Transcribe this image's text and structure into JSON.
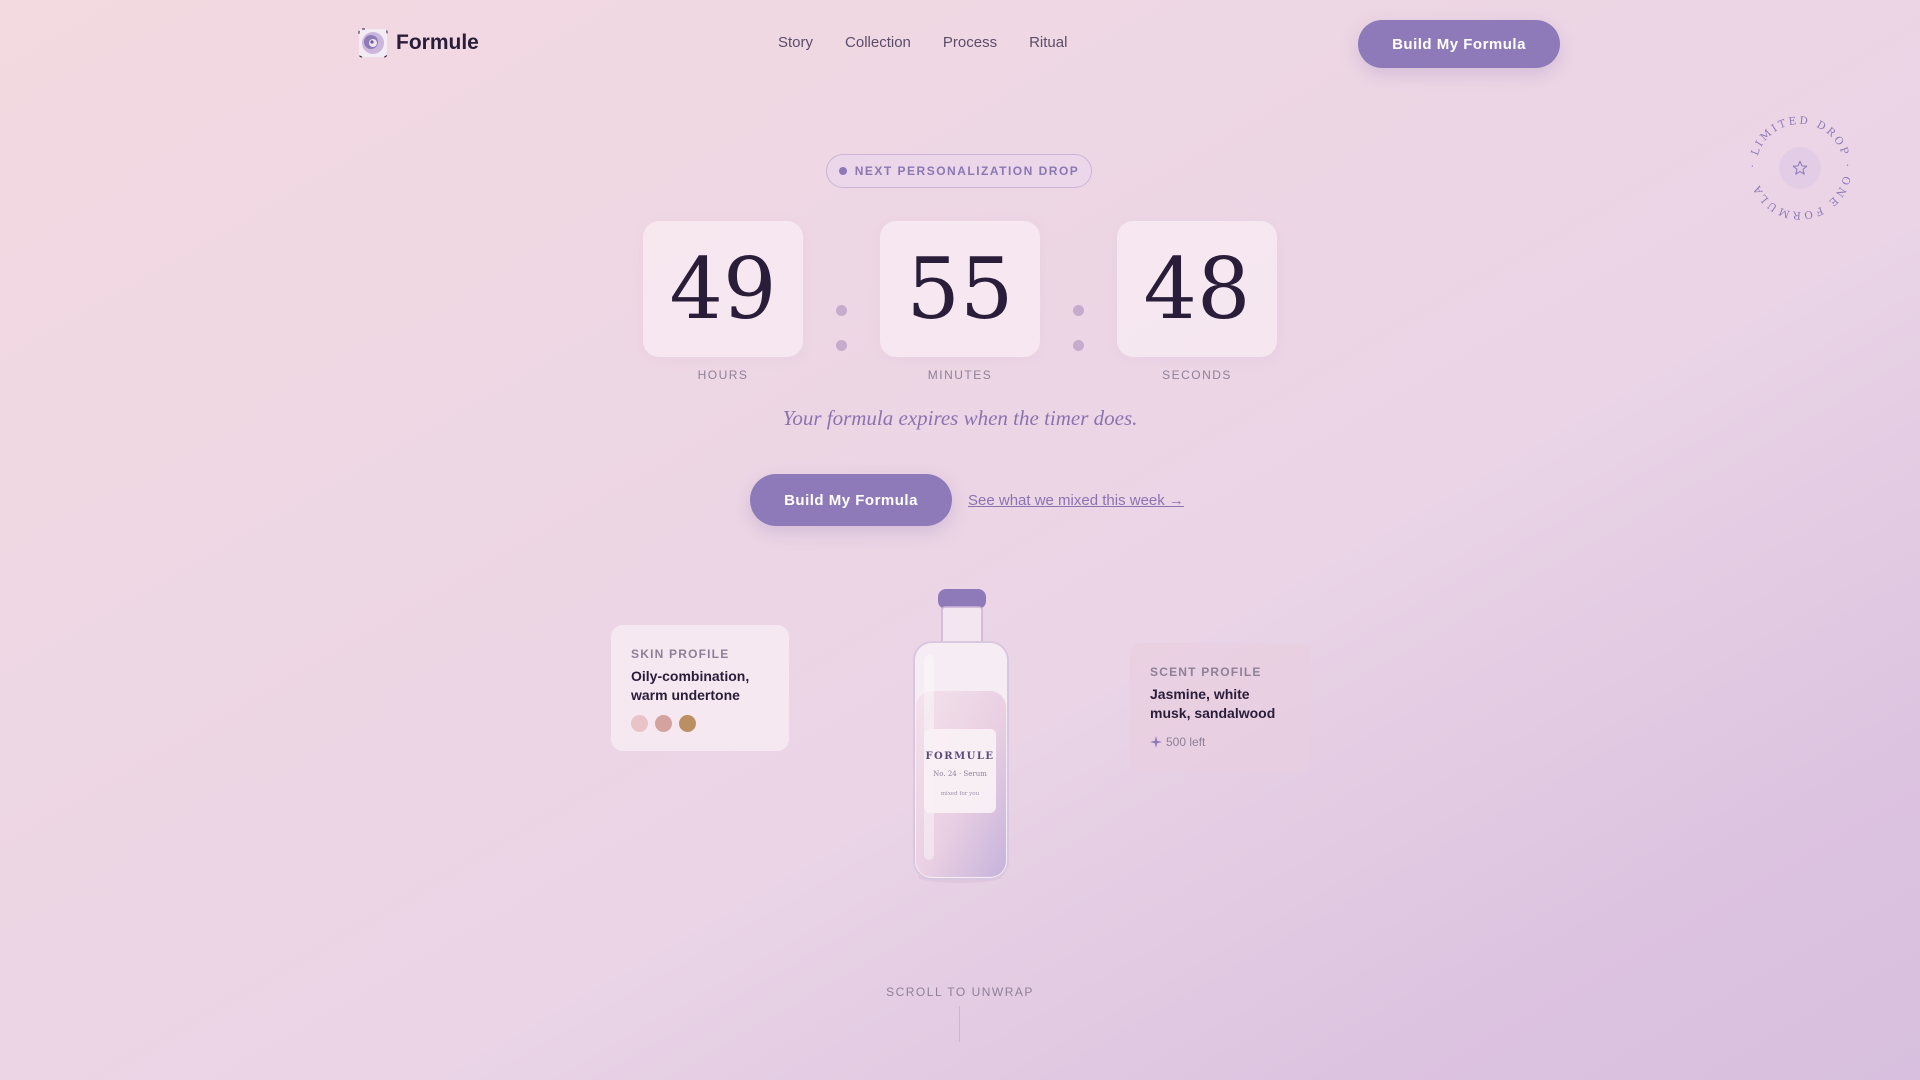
{
  "brand": {
    "name": "Formule"
  },
  "nav": {
    "items": [
      "Story",
      "Collection",
      "Process",
      "Ritual"
    ]
  },
  "header": {
    "cta_label": "Build My Formula"
  },
  "badge": {
    "ring_text": "· LIMITED DROP · ONE FORMULA"
  },
  "hero": {
    "drop_label": "NEXT PERSONALIZATION DROP",
    "timer": {
      "hours": "49",
      "minutes": "55",
      "seconds": "48",
      "hours_label": "HOURS",
      "minutes_label": "MINUTES",
      "seconds_label": "SECONDS"
    },
    "tagline": "Your formula expires when the timer does.",
    "cta_label": "Build My Formula",
    "secondary_link": "See what we mixed this week →"
  },
  "skin_card": {
    "label": "SKIN PROFILE",
    "line1": "Oily-combination,",
    "line2": "warm undertone",
    "swatches": [
      "#e8c3c8",
      "#d4a39f",
      "#bc8e63"
    ]
  },
  "bottle": {
    "brand": "FORMULE",
    "number": "No. 24 · Serum",
    "note": "mixed for you"
  },
  "scent_card": {
    "label": "SCENT PROFILE",
    "line1": "Jasmine, white",
    "line2": "musk, sandalwood",
    "remaining": "500 left"
  },
  "footer": {
    "scroll_label": "SCROLL TO UNWRAP"
  },
  "colors": {
    "accent": "#8e7ab8",
    "ink": "#2a1d3a",
    "muted": "#8f8098"
  }
}
